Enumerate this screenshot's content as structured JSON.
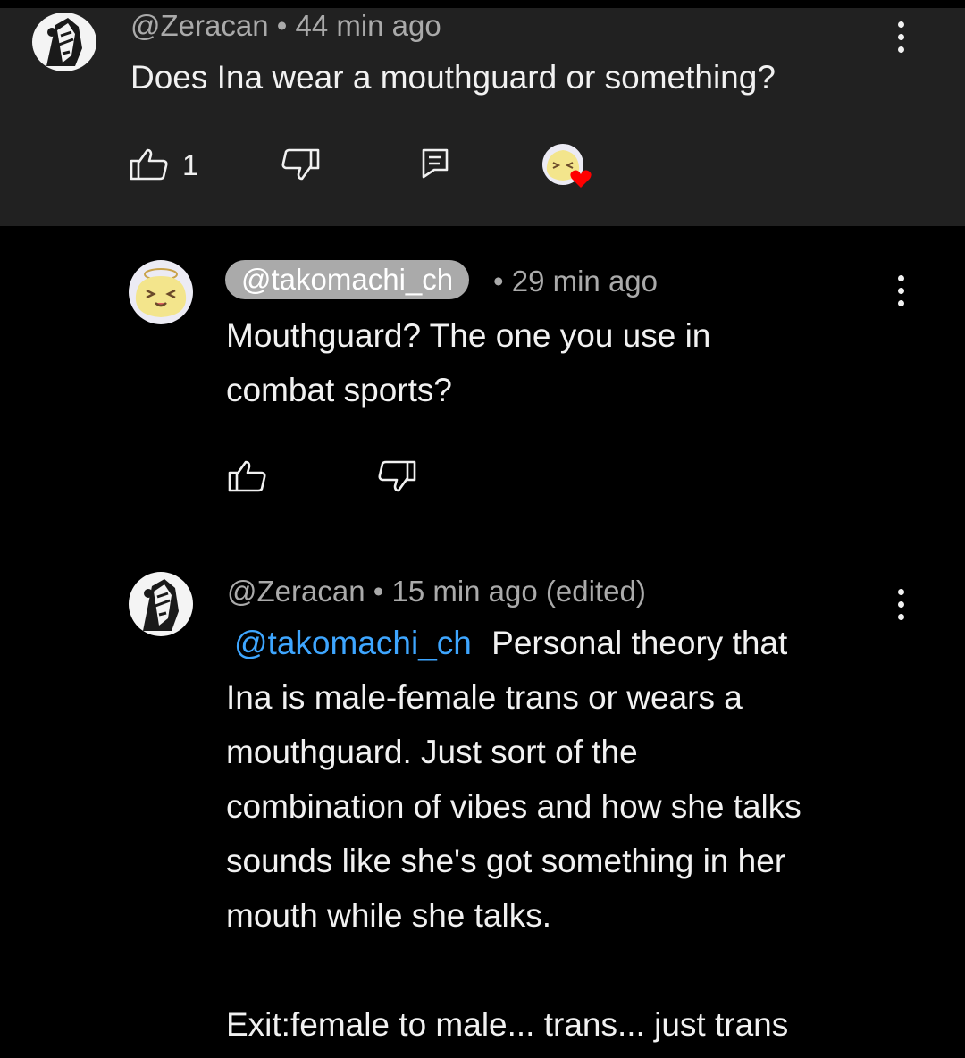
{
  "parent_comment": {
    "author": "@Zeracan",
    "time": "44 min ago",
    "text": "Does Ina wear a mouthguard or something?",
    "like_count": "1",
    "icons": {
      "like": "thumbs-up-icon",
      "dislike": "thumbs-down-icon",
      "reply": "reply-icon",
      "creator_heart": "creator-heart-icon",
      "menu": "more-vert-icon"
    }
  },
  "replies": [
    {
      "author": "@takomachi_ch",
      "time": "29 min ago",
      "lines": [
        "Mouthguard? The one you use in",
        "combat sports?"
      ]
    },
    {
      "author": "@Zeracan",
      "time": "15 min ago (edited)",
      "mention": "@takomachi_ch",
      "lines": [
        "Personal theory that",
        "Ina is male-female trans or wears a",
        "mouthguard. Just sort of the",
        "combination of vibes and how she talks",
        "sounds like she's got something in her",
        "mouth while she talks.",
        "",
        "Exit:female to male... trans... just trans"
      ]
    }
  ],
  "colors": {
    "background": "#000000",
    "highlight_background": "#212121",
    "text": "#f1f1f1",
    "meta_text": "#aaaaaa",
    "mention": "#3ea6ff",
    "heart": "#ff0000"
  }
}
